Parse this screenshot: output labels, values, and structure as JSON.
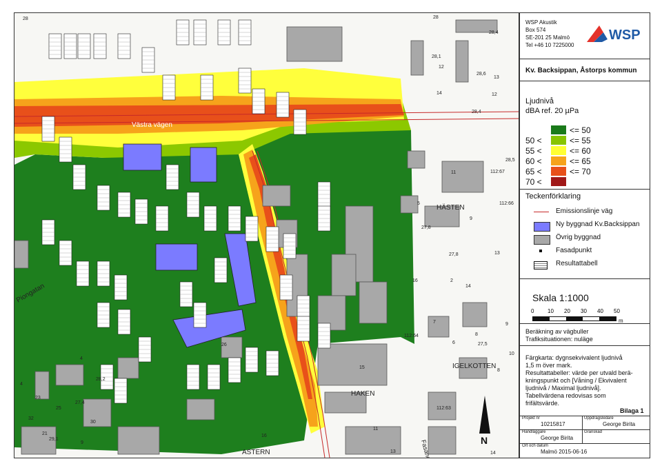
{
  "company": {
    "name": "WSP Akustik",
    "address1": "Box 574",
    "address2": "SE-201 25 Malmö",
    "phone": "Tel +46 10 7225000",
    "logo": "WSP"
  },
  "title": "Kv. Backsippan, Åstorps kommun",
  "noise_legend": {
    "heading": "Ljudnivå",
    "unit": "dBA ref. 20 µPa",
    "classes": [
      {
        "lower": "",
        "upper": "<= 50",
        "color": "#1a7a1a"
      },
      {
        "lower": "50 <",
        "upper": "<= 55",
        "color": "#88c400"
      },
      {
        "lower": "55 <",
        "upper": "<= 60",
        "color": "#ffff33"
      },
      {
        "lower": "60 <",
        "upper": "<= 65",
        "color": "#f6a31b"
      },
      {
        "lower": "65 <",
        "upper": "<= 70",
        "color": "#e8501a"
      },
      {
        "lower": "70 <",
        "upper": "",
        "color": "#a01818"
      }
    ]
  },
  "symbol_legend": {
    "heading": "Teckenförklaring",
    "items": [
      {
        "label": "Emissionslinje väg",
        "icon": "road-emission-line-icon"
      },
      {
        "label": "Ny byggnad Kv.Backsippan",
        "icon": "new-building-icon",
        "color": "#7b7bff"
      },
      {
        "label": "Övrig byggnad",
        "icon": "other-building-icon",
        "color": "#a8a8a8"
      },
      {
        "label": "Fasadpunkt",
        "icon": "facade-point-icon"
      },
      {
        "label": "Resultattabell",
        "icon": "result-table-icon"
      }
    ]
  },
  "scale": {
    "label": "Skala 1:1000",
    "ticks": [
      "0",
      "10",
      "20",
      "30",
      "40",
      "50"
    ],
    "unit": "m"
  },
  "calculation": {
    "line1": "Beräkning av vägbuller",
    "line2": "Trafiksituationen: nuläge"
  },
  "notes": [
    "Färgkarta: dygnsekvivalent ljudnivå",
    "1,5 m över mark.",
    "Resultattabeller: värde per utvald berä-",
    "kningspunkt och [Våning / Ekvivalent",
    "ljudnivå / Maximal ljudnivå].",
    "Tabellvärdena redovisas som",
    "frifältsvärde."
  ],
  "appendix": "Bilaga 1",
  "title_block": {
    "project_label": "Projekt nr",
    "project_no": "10215817",
    "orderer_label": "Uppdragsledare",
    "orderer": "George Birita",
    "handler_label": "Handläggare",
    "handler": "George Birita",
    "drawn_label": "Granskad",
    "place_label": "Ort och datum",
    "place_date": "Malmö 2015-06-16"
  },
  "map_labels": {
    "vastra_vagen": "Västra vägen",
    "piongatan": "Piongatan",
    "hastens": "HÄSTEN",
    "igelkotten": "IGELKOTTEN",
    "haken": "HAKEN",
    "astern": "ASTERN",
    "fasanogatan": "Fasanogatan",
    "lot_numbers": [
      "28",
      "28,4",
      "12",
      "28,1",
      "13",
      "28,6",
      "14",
      "12",
      "28,4",
      "11",
      "28,5",
      "112:67",
      "5",
      "9",
      "112:66",
      "27,8",
      "27,8",
      "13",
      "16",
      "2",
      "14",
      "7",
      "9",
      "6",
      "8",
      "27,5",
      "112:64",
      "10",
      "15",
      "26",
      "4",
      "112:63",
      "11",
      "14",
      "16",
      "9",
      "13",
      "8",
      "4",
      "28,2",
      "27,4",
      "21",
      "30",
      "32",
      "25",
      "23",
      "29,1",
      "28"
    ]
  },
  "north_arrow": "N"
}
